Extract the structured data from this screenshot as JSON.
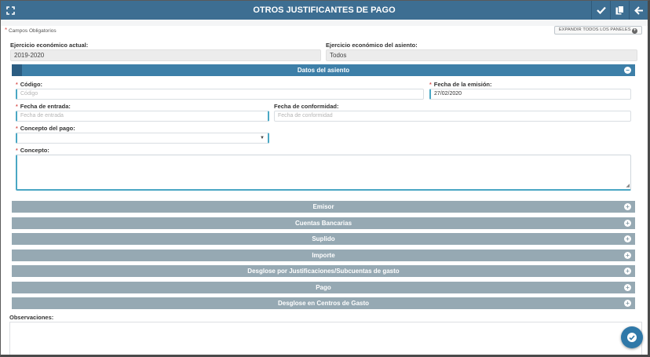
{
  "header": {
    "title": "OTROS JUSTIFICANTES DE PAGO"
  },
  "toolbar": {
    "required_note": "Campos Obligatorios",
    "expand_all_label": "EXPANDIR TODOS LOS PANELES"
  },
  "ejercicio": {
    "actual_label": "Ejercicio económico actual:",
    "actual_value": "2019-2020",
    "asiento_label": "Ejercicio económico del asiento:",
    "asiento_value": "Todos"
  },
  "datos_asiento": {
    "title": "Datos del asiento",
    "codigo_label": "Código:",
    "codigo_placeholder": "Código",
    "fecha_emision_label": "Fecha de la emisión:",
    "fecha_emision_value": "27/02/2020",
    "fecha_entrada_label": "Fecha de entrada:",
    "fecha_entrada_placeholder": "Fecha de entrada",
    "fecha_conformidad_label": "Fecha de conformidad:",
    "fecha_conformidad_placeholder": "Fecha de conformidad",
    "concepto_pago_label": "Concepto del pago:",
    "concepto_pago_value": "",
    "concepto_label": "Concepto:",
    "concepto_value": ""
  },
  "panels": [
    {
      "label": "Emisor"
    },
    {
      "label": "Cuentas Bancarias"
    },
    {
      "label": "Suplido"
    },
    {
      "label": "Importe"
    },
    {
      "label": "Desglose por Justificaciones/Subcuentas de gasto"
    },
    {
      "label": "Pago"
    },
    {
      "label": "Desglose en Centros de Gasto"
    }
  ],
  "observaciones": {
    "label": "Observaciones:",
    "value": ""
  },
  "icons": {
    "fullscreen": "fullscreen-icon",
    "save": "check-icon",
    "copy": "copy-icon",
    "back": "arrow-left-icon",
    "collapse": "minus-circle-icon",
    "expand": "plus-circle-icon",
    "fab": "check-circle-icon"
  },
  "colors": {
    "header": "#3d6e92",
    "panel_active": "#3d7fa8",
    "panel_collapsed": "#96a9b3",
    "required_star": "#d9534f",
    "input_accent": "#4aa7c4"
  }
}
